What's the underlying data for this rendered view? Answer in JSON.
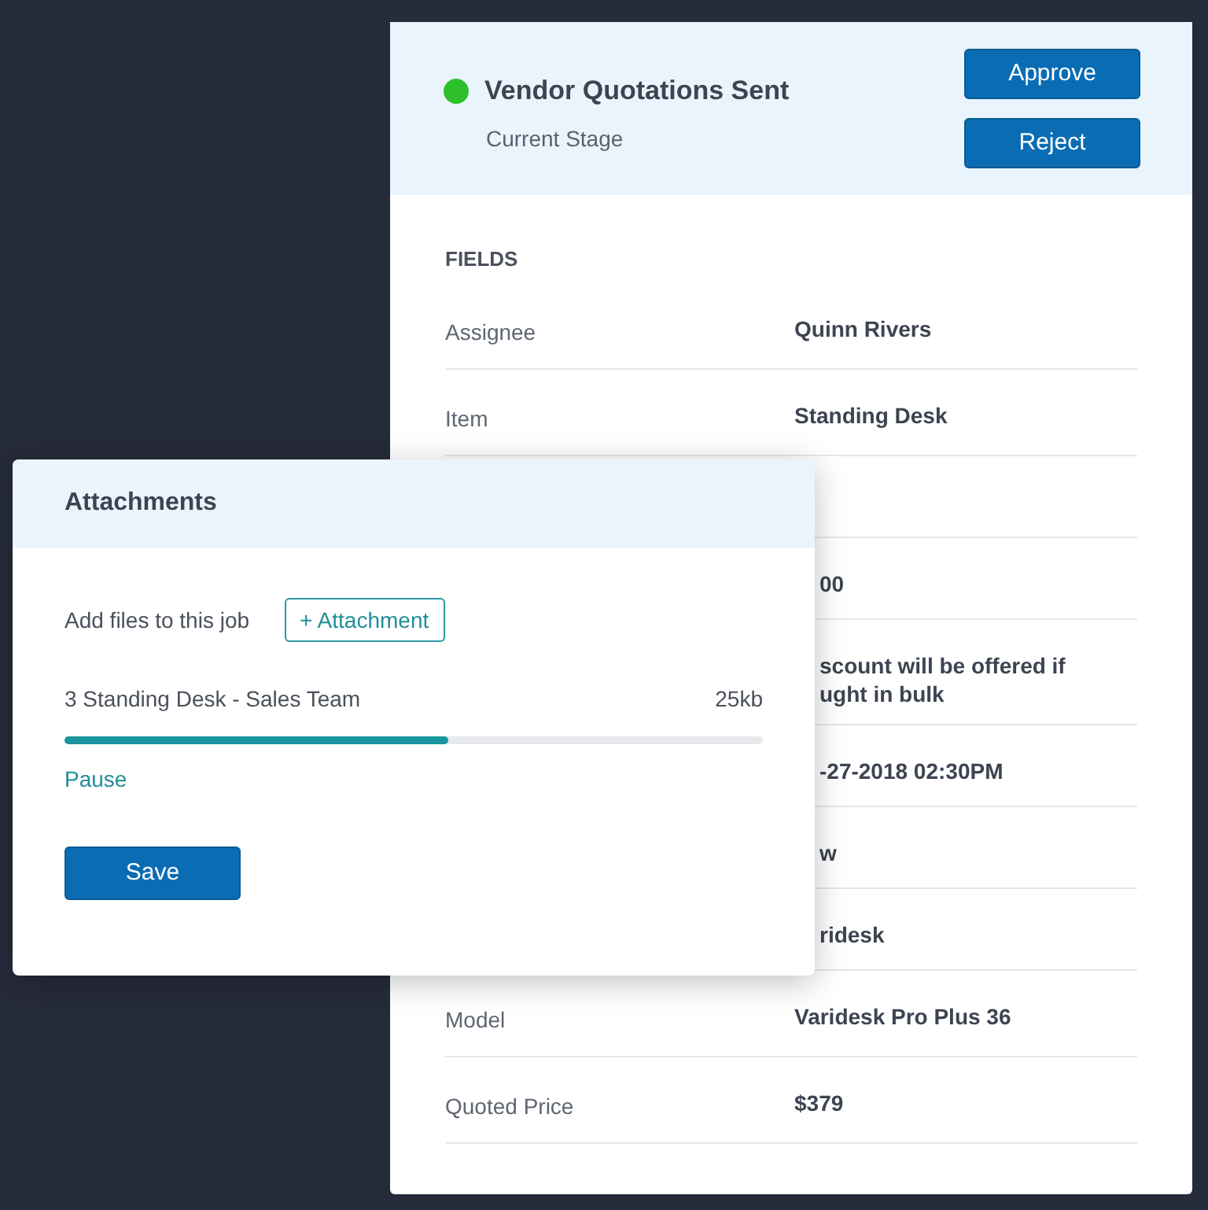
{
  "stage": {
    "title": "Vendor Quotations Sent",
    "subtitle": "Current Stage",
    "color": "#2ec02a"
  },
  "actions": [
    "Approve",
    "Reject"
  ],
  "fields": {
    "heading": "FIELDS",
    "rows": [
      {
        "label": "Assignee",
        "value": "Quinn Rivers"
      },
      {
        "label": "Item",
        "value": "Standing Desk"
      },
      {},
      {
        "value": "00"
      },
      {
        "value": "scount will be offered if",
        "value_line_2": "ught in bulk"
      },
      {
        "value": "-27-2018 02:30PM"
      },
      {
        "value": "w"
      },
      {
        "value": "ridesk"
      },
      {
        "label": "Model",
        "value": "Varidesk Pro Plus 36"
      },
      {
        "label": "Quoted Price",
        "value": "$379"
      }
    ]
  },
  "attachments": {
    "title": "Attachments",
    "prompt": "Add files to this job",
    "add_button": "+ Attachment",
    "file": {
      "name": "3 Standing Desk - Sales Team",
      "size": "25kb",
      "level": 0.55,
      "action": "Pause"
    },
    "save_button": "Save"
  }
}
